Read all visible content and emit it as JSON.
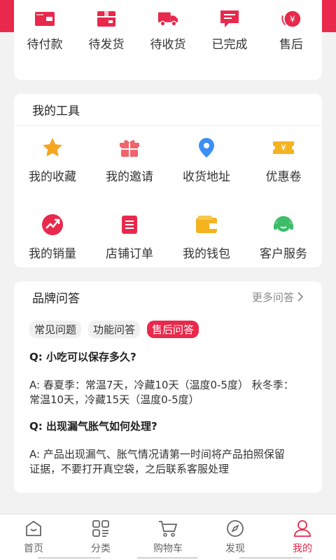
{
  "colors": {
    "accent": "#e8294b",
    "yellow": "#f5a623",
    "blue": "#3b8ff5",
    "green": "#3dbd6a"
  },
  "orders": {
    "items": [
      {
        "label": "待付款",
        "icon": "wallet-icon"
      },
      {
        "label": "待发货",
        "icon": "package-icon"
      },
      {
        "label": "待收货",
        "icon": "truck-icon"
      },
      {
        "label": "已完成",
        "icon": "message-icon"
      },
      {
        "label": "售后",
        "icon": "refund-icon"
      }
    ]
  },
  "tools": {
    "title": "我的工具",
    "items": [
      {
        "label": "我的收藏",
        "icon": "star-icon"
      },
      {
        "label": "我的邀请",
        "icon": "gift-icon"
      },
      {
        "label": "收货地址",
        "icon": "location-pin-icon"
      },
      {
        "label": "优惠卷",
        "icon": "coupon-icon"
      },
      {
        "label": "我的销量",
        "icon": "trend-up-icon"
      },
      {
        "label": "店铺订单",
        "icon": "document-icon"
      },
      {
        "label": "我的钱包",
        "icon": "wallet-yellow-icon"
      },
      {
        "label": "客户服务",
        "icon": "headset-icon"
      }
    ]
  },
  "qa": {
    "title": "品牌问答",
    "more": "更多问答",
    "tabs": [
      "常见问题",
      "功能问答",
      "售后问答"
    ],
    "active_tab": "售后问答",
    "items": [
      {
        "q": "Q:  小吃可以保存多久?",
        "a1": "A:   春夏季：常温7天，冷藏10天（温度0-5度） 秋冬季：",
        "a2": "常温10天，冷藏15天（温度0-5度）"
      },
      {
        "q": "Q:  出现漏气胀气如何处理?",
        "a1": "A:   产品出现漏气、胀气情况请第一时间将产品拍照保留",
        "a2": "证据，不要打开真空袋，之后联系客服处理"
      }
    ]
  },
  "nav": {
    "items": [
      {
        "label": "首页",
        "icon": "home-icon"
      },
      {
        "label": "分类",
        "icon": "category-icon"
      },
      {
        "label": "购物车",
        "icon": "cart-icon"
      },
      {
        "label": "发现",
        "icon": "compass-icon"
      },
      {
        "label": "我的",
        "icon": "user-icon"
      }
    ],
    "active": "我的"
  }
}
